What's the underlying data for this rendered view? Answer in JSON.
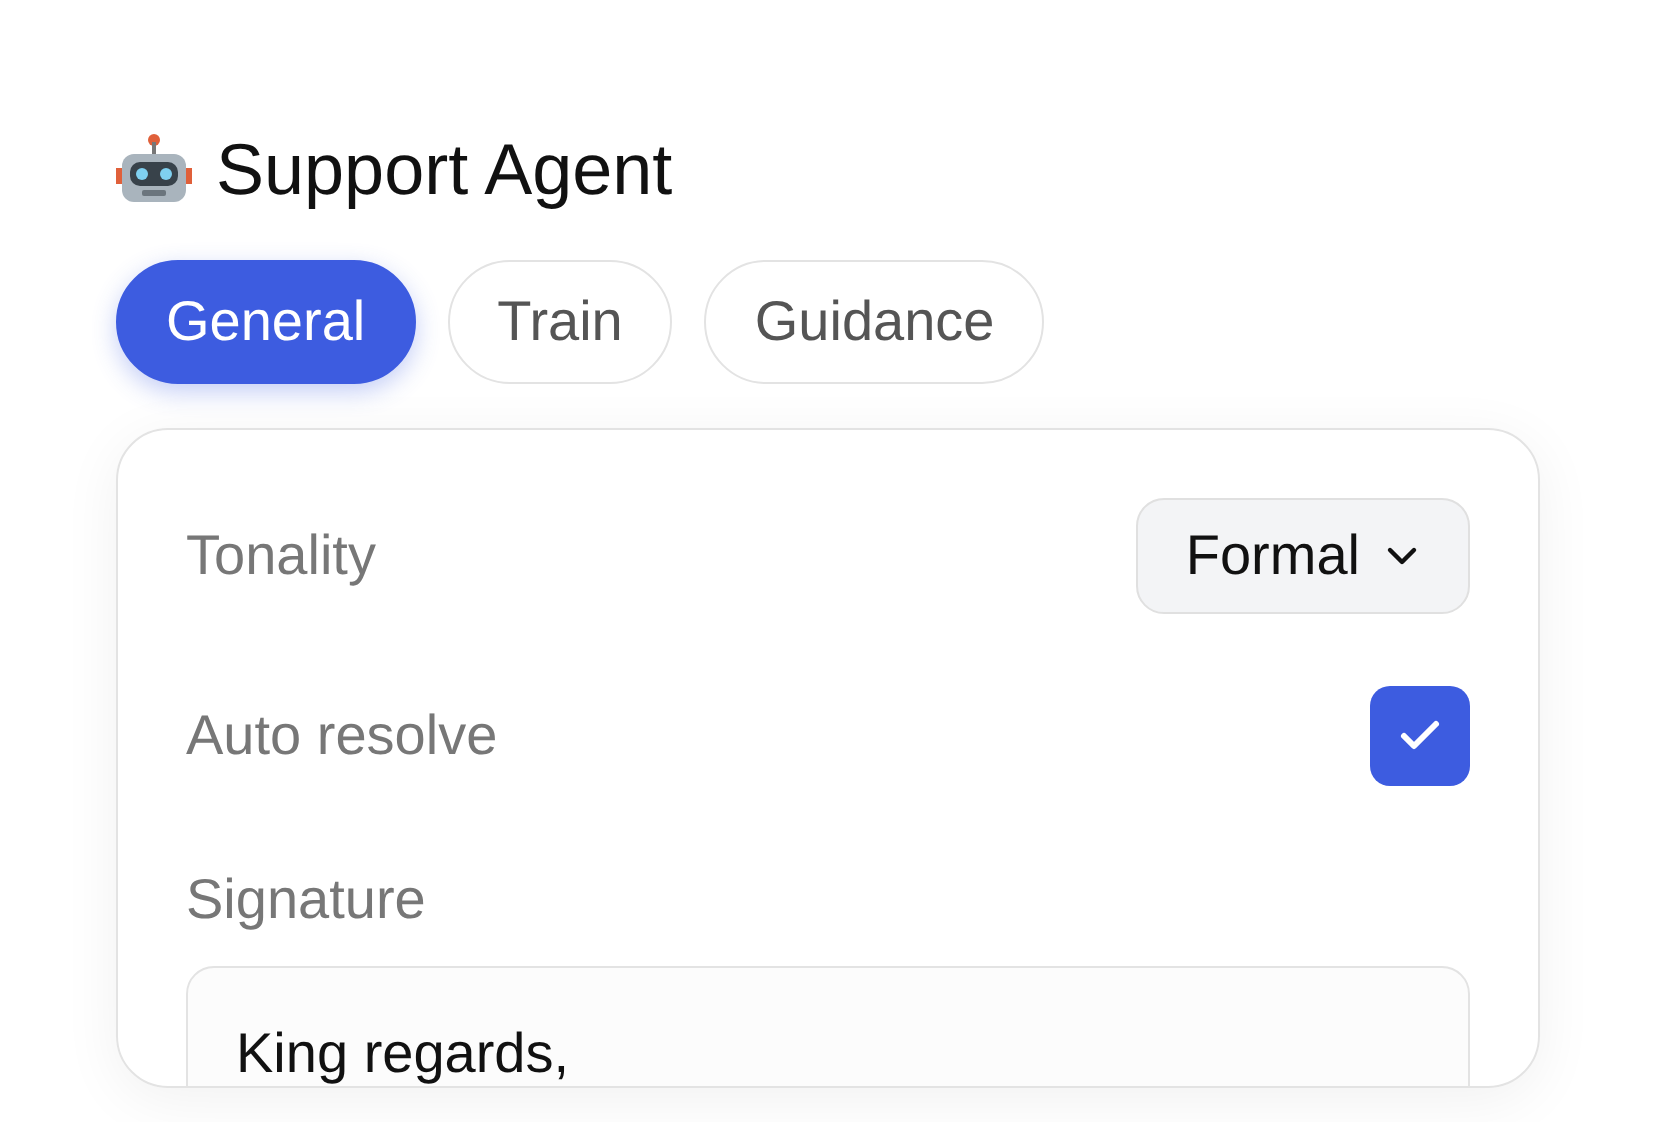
{
  "title": "Support Agent",
  "tabs": [
    {
      "label": "General",
      "selected": true
    },
    {
      "label": "Train",
      "selected": false
    },
    {
      "label": "Guidance",
      "selected": false
    }
  ],
  "settings": [
    {
      "kind": "select",
      "label": "Tonality",
      "value": "Formal"
    },
    {
      "kind": "checkbox",
      "label": "Auto resolve",
      "checked": true
    }
  ],
  "signature": {
    "label": "Signature",
    "value": "King regards,"
  }
}
